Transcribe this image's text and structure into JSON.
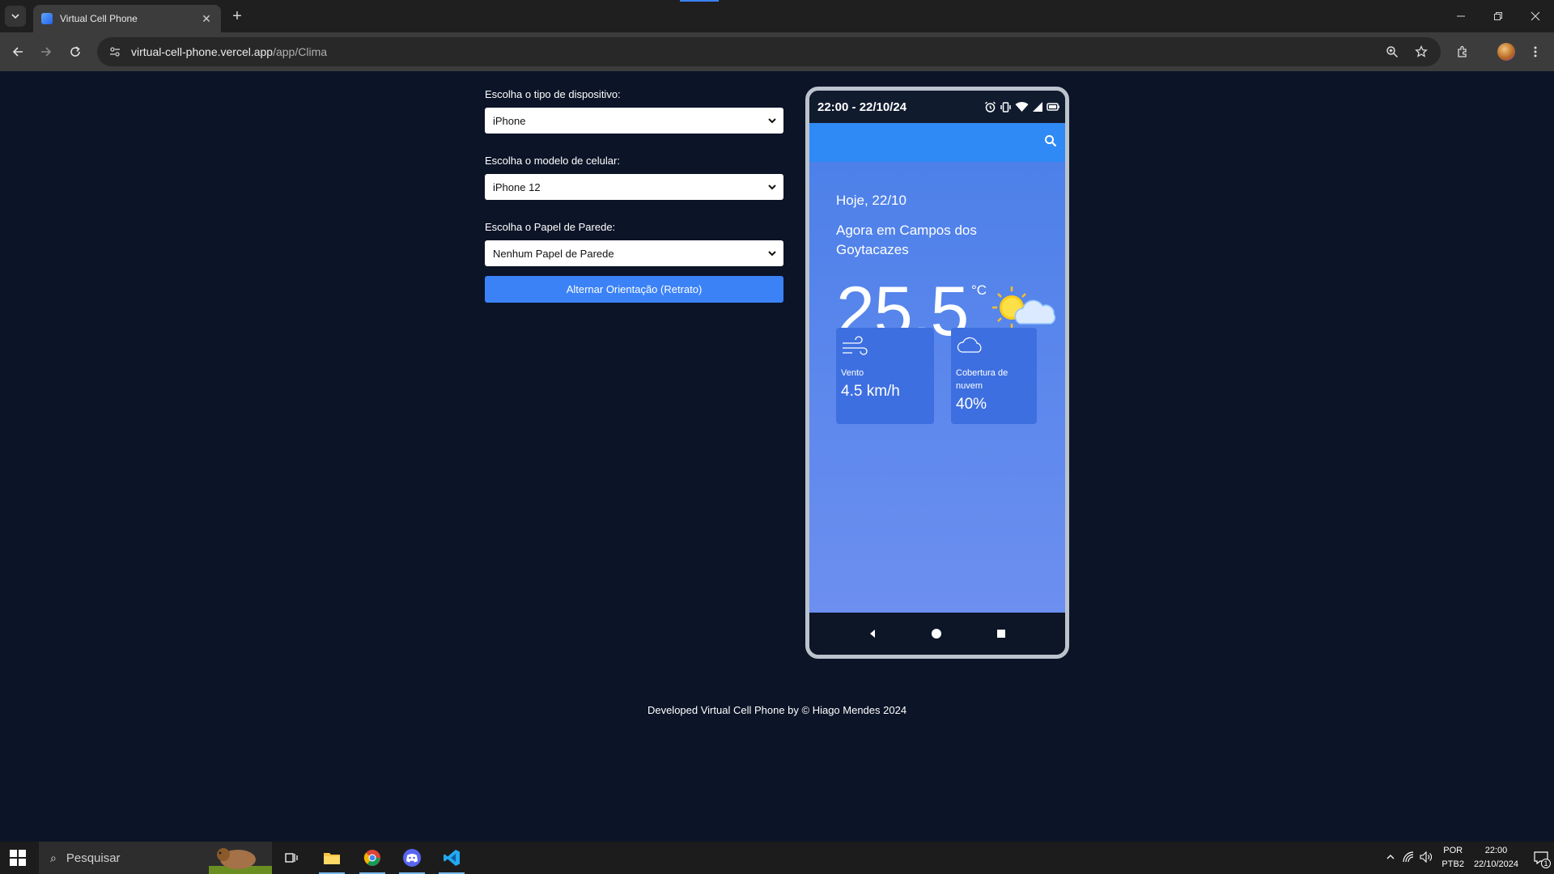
{
  "browser": {
    "tab_title": "Virtual Cell Phone",
    "url_host": "virtual-cell-phone.vercel.app",
    "url_path": "/app/Clima",
    "new_tab": "+",
    "close_tab": "✕"
  },
  "controls": {
    "device_type_label": "Escolha o tipo de dispositivo:",
    "device_type_value": "iPhone",
    "model_label": "Escolha o modelo de celular:",
    "model_value": "iPhone 12",
    "wallpaper_label": "Escolha o Papel de Parede:",
    "wallpaper_value": "Nenhum Papel de Parede",
    "toggle_button": "Alternar Orientação (Retrato)"
  },
  "phone": {
    "status_time": "22:00 - 22/10/24",
    "weather": {
      "date": "Hoje, 22/10",
      "location": "Agora em Campos dos Goytacazes",
      "temperature": "25.5",
      "unit": "°C",
      "wind_label": "Vento",
      "wind_value": "4.5 km/h",
      "cloud_label": "Cobertura de nuvem",
      "cloud_value": "40%"
    }
  },
  "footer": "Developed Virtual Cell Phone by © Hiago Mendes 2024",
  "taskbar": {
    "search_placeholder": "Pesquisar",
    "lang_line1": "POR",
    "lang_line2": "PTB2",
    "time": "22:00",
    "date": "22/10/2024",
    "notification_count": "1"
  },
  "colors": {
    "page_bg": "#0c1427",
    "accent": "#3b82f6",
    "phone_screen_top": "#4a7fe8",
    "appbar": "#2f8af5"
  }
}
